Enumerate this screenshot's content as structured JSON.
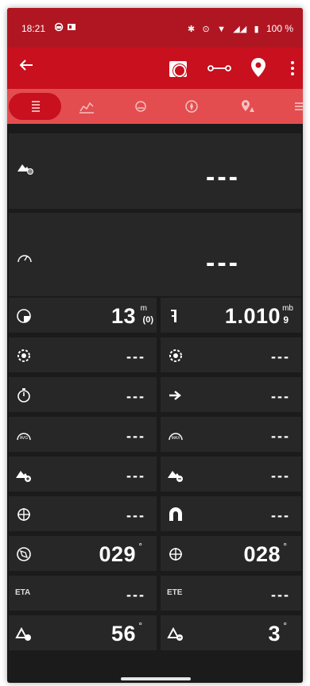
{
  "status_bar": {
    "time": "18:21",
    "battery_percent": "100 %"
  },
  "top_card": {
    "value": "---"
  },
  "second_card": {
    "value": "---"
  },
  "grid": {
    "row1": {
      "left_value": "13",
      "left_unit": "m",
      "left_sub": "(0)",
      "right_value": "1.010",
      "right_unit": "mb",
      "right_sub": "9"
    },
    "row2": {
      "left": "---",
      "right": "---"
    },
    "row3": {
      "left": "---",
      "right": "---"
    },
    "row4": {
      "left": "---",
      "right": "---"
    },
    "row5": {
      "left": "---",
      "right": "---"
    },
    "row6": {
      "left": "---",
      "right": "---"
    },
    "row7": {
      "left": "029",
      "right": "028",
      "deg": "°"
    },
    "row8": {
      "left_label": "ETA",
      "left": "---",
      "right_label": "ETE",
      "right": "---"
    },
    "row9": {
      "left": "56",
      "right": "3",
      "deg": "°"
    }
  },
  "icons": {
    "back": "arrow-left-icon",
    "record": "record-icon",
    "route": "route-icon",
    "waypoint": "map-pin-icon",
    "more": "more-vert-icon"
  },
  "colors": {
    "status_bar": "#b01622",
    "app_bar": "#c8101e",
    "tab_bar": "#e34d4f",
    "background": "#1b1b1b",
    "cell": "#272727"
  }
}
